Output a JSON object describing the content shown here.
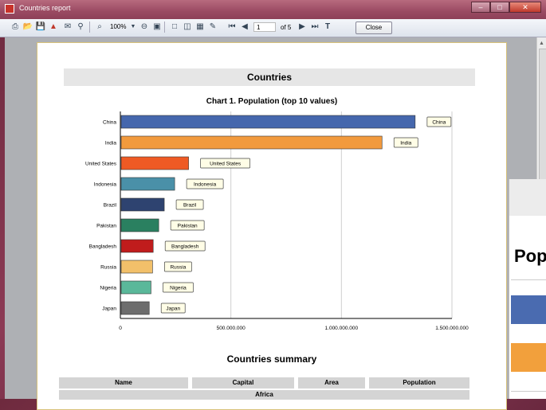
{
  "window": {
    "title": "Countries report"
  },
  "toolbar": {
    "zoom": "100%",
    "page": "1",
    "of_pages": "of 5",
    "close_label": "Close"
  },
  "report": {
    "header": "Countries",
    "chart_title": "Chart 1. Population (top 10 values)",
    "summary_title": "Countries summary",
    "table_headers": [
      "Name",
      "Capital",
      "Area",
      "Population"
    ],
    "region": "Africa"
  },
  "popup": {
    "text": "Pop"
  },
  "chart_data": {
    "type": "bar",
    "orientation": "horizontal",
    "title": "Chart 1. Population (top 10 values)",
    "categories": [
      "China",
      "India",
      "United States",
      "Indonesia",
      "Brazil",
      "Pakistan",
      "Bangladesh",
      "Russia",
      "Nigeria",
      "Japan"
    ],
    "values": [
      1330000000,
      1180000000,
      305000000,
      242000000,
      195000000,
      170000000,
      145000000,
      142000000,
      135000000,
      127000000
    ],
    "colors": [
      "#4567ad",
      "#f29a3d",
      "#ef5a24",
      "#4a90a8",
      "#2e4370",
      "#2a8060",
      "#c01c1c",
      "#f2c06a",
      "#5ab89a",
      "#6d6d6d"
    ],
    "xticks": [
      "0",
      "500.000.000",
      "1.000.000.000",
      "1.500.000.000"
    ],
    "xlim": [
      0,
      1500000000
    ],
    "grid": true,
    "data_labels": [
      "China",
      "India",
      "United States",
      "Indonesia",
      "Brazil",
      "Pakistan",
      "Bangladesh",
      "Russia",
      "Nigeria",
      "Japan"
    ]
  }
}
